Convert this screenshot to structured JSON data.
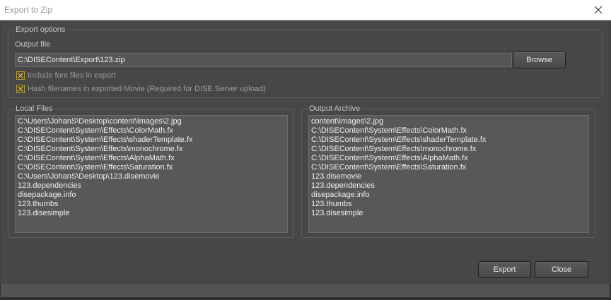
{
  "window": {
    "title": "Export to Zip",
    "close_icon": "close-icon"
  },
  "export_options": {
    "legend": "Export options",
    "output_file_label": "Output file",
    "output_file_value": "C:\\DISEContent\\Export\\123.zip",
    "browse_label": "Browse",
    "include_fonts": {
      "label": "Include font files in export",
      "checked": true
    },
    "hash_filenames": {
      "label": "Hash filenames in exported Movie (Required for DISE Server upload)",
      "checked": true
    }
  },
  "local_files": {
    "legend": "Local Files",
    "items": [
      "C:\\Users\\JohanS\\Desktop\\content\\Images\\2.jpg",
      "C:\\DISEContent\\System\\Effects\\ColorMath.fx",
      "C:\\DISEContent\\System\\Effects\\shaderTemplate.fx",
      "C:\\DISEContent\\System\\Effects\\monochrome.fx",
      "C:\\DISEContent\\System\\Effects\\AlphaMath.fx",
      "C:\\DISEContent\\System\\Effects\\Saturation.fx",
      "C:\\Users\\JohanS\\Desktop\\123.disemovie",
      "123.dependencies",
      "disepackage.info",
      "123.thumbs",
      "123.disesimple"
    ]
  },
  "output_archive": {
    "legend": "Output Archive",
    "items": [
      "content\\Images\\2.jpg",
      "C:\\DISEContent\\System\\Effects\\ColorMath.fx",
      "C:\\DISEContent\\System\\Effects\\shaderTemplate.fx",
      "C:\\DISEContent\\System\\Effects\\monochrome.fx",
      "C:\\DISEContent\\System\\Effects\\AlphaMath.fx",
      "C:\\DISEContent\\System\\Effects\\Saturation.fx",
      "123.disemovie",
      "123.dependencies",
      "disepackage.info",
      "123.thumbs",
      "123.disesimple"
    ]
  },
  "footer": {
    "export_label": "Export",
    "close_label": "Close"
  },
  "colors": {
    "background": "#474747",
    "list_background": "#585858",
    "checkbox_accent": "#b89a2a"
  }
}
